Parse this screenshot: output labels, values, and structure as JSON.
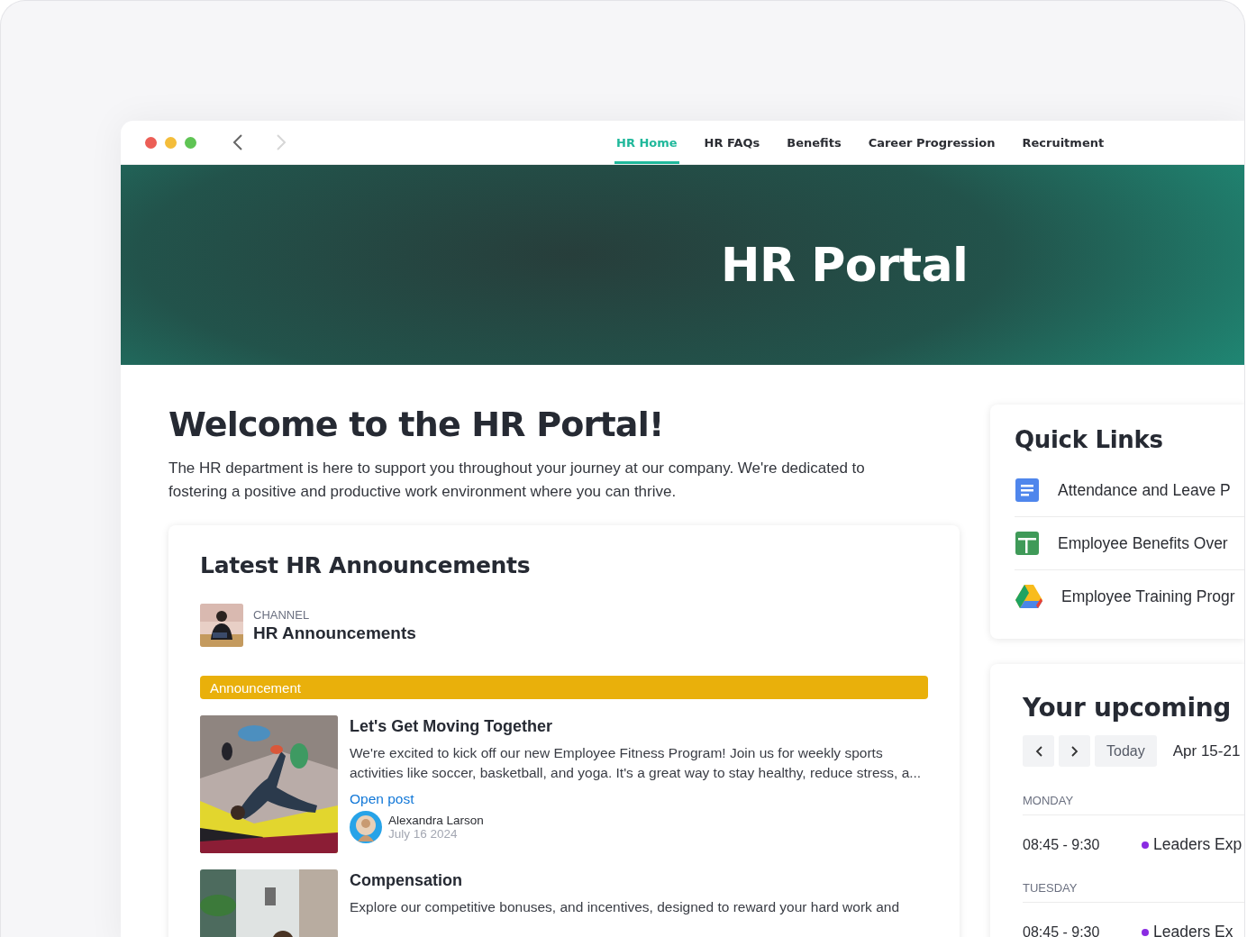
{
  "nav_buttons": [
    {
      "kind": "back",
      "disabled": false
    },
    {
      "kind": "forward",
      "disabled": true
    }
  ],
  "tabs": [
    {
      "label": "HR Home",
      "selected": true
    },
    {
      "label": "HR FAQs",
      "selected": false
    },
    {
      "label": "Benefits",
      "selected": false
    },
    {
      "label": "Career Progression",
      "selected": false
    },
    {
      "label": "Recruitment",
      "selected": false
    }
  ],
  "hero": {
    "title": "HR Portal"
  },
  "welcome": {
    "title": "Welcome to the HR Portal!",
    "text": "The HR department is here to support you throughout your journey at our company. We're dedicated to fostering a positive and productive work environment where you can thrive."
  },
  "announcements": {
    "title": "Latest HR Announcements",
    "channel": {
      "label": "CHANNEL",
      "name": "HR Announcements"
    },
    "category": "Announcement",
    "posts": [
      {
        "title": "Let's Get Moving Together",
        "body": "We're excited to kick off our new Employee Fitness Program! Join us for weekly sports activities like soccer, basketball, and yoga. It's a great way to stay healthy, reduce stress, a...",
        "link": "Open post",
        "author": "Alexandra Larson",
        "date": "July 16 2024"
      },
      {
        "title": "Compensation",
        "body": "Explore our competitive bonuses, and incentives, designed to reward your hard work and"
      }
    ]
  },
  "quick_links": {
    "title": "Quick Links",
    "items": [
      {
        "kind": "doc",
        "label": "Attendance and Leave P"
      },
      {
        "kind": "sheet",
        "label": "Employee Benefits Over"
      },
      {
        "kind": "drive",
        "label": "Employee Training Progr"
      }
    ]
  },
  "events": {
    "title": "Your upcoming",
    "today": "Today",
    "range": "Apr 15-21",
    "days": [
      {
        "day": "MONDAY",
        "events": [
          {
            "time": "08:45 - 9:30",
            "title": "Leaders Exp",
            "color": "#8a2be2"
          }
        ]
      },
      {
        "day": "TUESDAY",
        "events": [
          {
            "time": "08:45 - 9:30",
            "title": "Leaders Ex",
            "color": "#8a2be2"
          }
        ]
      }
    ]
  }
}
